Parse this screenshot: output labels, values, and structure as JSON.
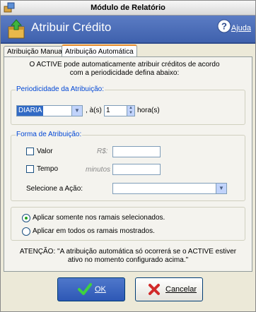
{
  "window": {
    "title": "Módulo de Relatório"
  },
  "header": {
    "title": "Atribuir Crédito",
    "help_label": "Ajuda"
  },
  "tabs": [
    {
      "label": "Atribuição Manual",
      "active": false
    },
    {
      "label": "Atribuição Automática",
      "active": true
    }
  ],
  "intro": "O ACTIVE pode automaticamente atribuir créditos de acordo com a periodicidade defina abaixo:",
  "periodicidade": {
    "legend": "Periodicidade da Atribuição:",
    "frequency_value": "DIARIA",
    "at_label": ", à(s)",
    "hour_value": "1",
    "hour_label": "hora(s)"
  },
  "forma": {
    "legend": "Forma de Atribuição:",
    "valor_label": "Valor",
    "valor_checked": false,
    "currency_label": "R$:",
    "valor_value": "",
    "tempo_label": "Tempo",
    "tempo_checked": false,
    "minutes_label": "minutos",
    "tempo_value": "",
    "action_label": "Selecione a Ação:",
    "action_value": ""
  },
  "scope": {
    "option_selected": "Aplicar somente nos ramais selecionados.",
    "option_all": "Aplicar em todos os ramais mostrados."
  },
  "warning": "ATENÇÃO: \"A atribuição automática só ocorrerá se o ACTIVE estiver ativo no momento configurado acima.\"",
  "buttons": {
    "ok": "OK",
    "cancel": "Cancelar"
  },
  "colors": {
    "header": "#4a6cb8",
    "legend_text": "#0046d5",
    "radio_dot": "#21a121"
  }
}
